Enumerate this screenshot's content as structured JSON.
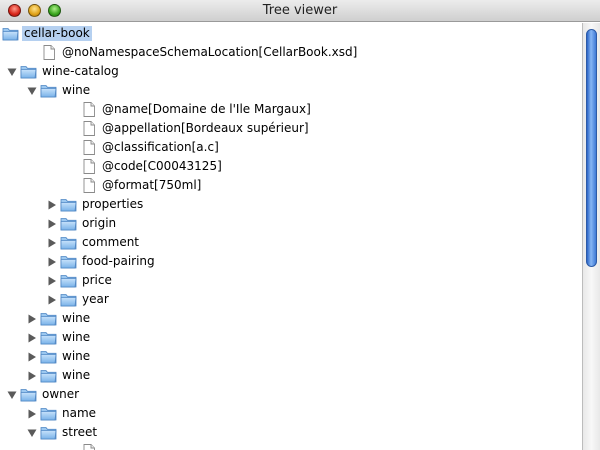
{
  "window": {
    "title": "Tree viewer"
  },
  "tree": {
    "rows": [
      {
        "label": "cellar-book",
        "type": "folder",
        "depth": 0,
        "toggle": "none",
        "selected": true
      },
      {
        "label": "@noNamespaceSchemaLocation[CellarBook.xsd]",
        "type": "file",
        "depth": 1,
        "toggle": "none"
      },
      {
        "label": "wine-catalog",
        "type": "folder",
        "depth": 0,
        "toggle": "expanded"
      },
      {
        "label": "wine",
        "type": "folder",
        "depth": 1,
        "toggle": "expanded"
      },
      {
        "label": "@name[Domaine de l'Ile Margaux]",
        "type": "file",
        "depth": 3,
        "toggle": "none"
      },
      {
        "label": "@appellation[Bordeaux supérieur]",
        "type": "file",
        "depth": 3,
        "toggle": "none"
      },
      {
        "label": "@classification[a.c]",
        "type": "file",
        "depth": 3,
        "toggle": "none"
      },
      {
        "label": "@code[C00043125]",
        "type": "file",
        "depth": 3,
        "toggle": "none"
      },
      {
        "label": "@format[750ml]",
        "type": "file",
        "depth": 3,
        "toggle": "none"
      },
      {
        "label": "properties",
        "type": "folder",
        "depth": 2,
        "toggle": "collapsed"
      },
      {
        "label": "origin",
        "type": "folder",
        "depth": 2,
        "toggle": "collapsed"
      },
      {
        "label": "comment",
        "type": "folder",
        "depth": 2,
        "toggle": "collapsed"
      },
      {
        "label": "food-pairing",
        "type": "folder",
        "depth": 2,
        "toggle": "collapsed"
      },
      {
        "label": "price",
        "type": "folder",
        "depth": 2,
        "toggle": "collapsed"
      },
      {
        "label": "year",
        "type": "folder",
        "depth": 2,
        "toggle": "collapsed"
      },
      {
        "label": "wine",
        "type": "folder",
        "depth": 1,
        "toggle": "collapsed"
      },
      {
        "label": "wine",
        "type": "folder",
        "depth": 1,
        "toggle": "collapsed"
      },
      {
        "label": "wine",
        "type": "folder",
        "depth": 1,
        "toggle": "collapsed"
      },
      {
        "label": "wine",
        "type": "folder",
        "depth": 1,
        "toggle": "collapsed"
      },
      {
        "label": "owner",
        "type": "folder",
        "depth": 0,
        "toggle": "expanded"
      },
      {
        "label": "name",
        "type": "folder",
        "depth": 1,
        "toggle": "collapsed"
      },
      {
        "label": "street",
        "type": "folder",
        "depth": 1,
        "toggle": "expanded"
      },
      {
        "label": "",
        "type": "file",
        "depth": 3,
        "toggle": "none"
      }
    ]
  },
  "colors": {
    "selection": "#b5d0f0",
    "scroll_thumb": "#3f7ad6"
  }
}
